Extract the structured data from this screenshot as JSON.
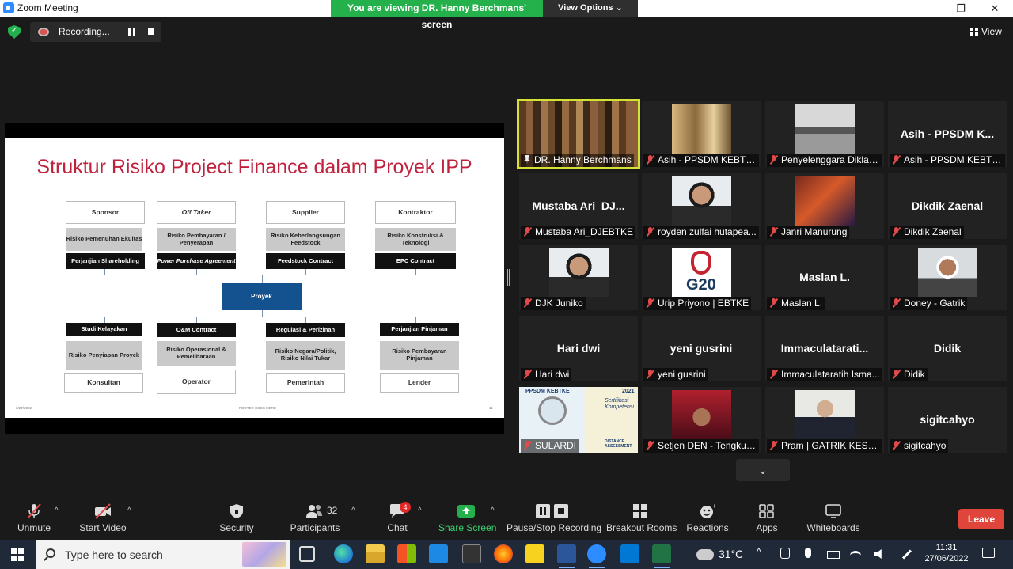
{
  "window": {
    "title": "Zoom Meeting",
    "minimize": "—",
    "maximize": "❐",
    "close": "✕"
  },
  "banner": {
    "viewing": "You are viewing DR. Hanny Berchmans' screen",
    "view_options": "View Options ⌄"
  },
  "recording": {
    "label": "Recording..."
  },
  "view_button": "View",
  "slide": {
    "title": "Struktur Risiko Project Finance dalam Proyek IPP",
    "top_columns": [
      {
        "header": "Sponsor",
        "risk": "Risiko Pemenuhan Ekuitas",
        "contract": "Perjanjian Shareholding"
      },
      {
        "header": "Off Taker",
        "risk": "Risiko Pembayaran / Penyerapan",
        "contract": "Power Purchase Agreement"
      },
      {
        "header": "Supplier",
        "risk": "Risiko Keberlangsungan Feedstock",
        "contract": "Feedstock Contract"
      },
      {
        "header": "Kontraktor",
        "risk": "Risiko Konstruksi & Teknologi",
        "contract": "EPC Contract"
      }
    ],
    "center": "Proyek",
    "bottom_columns": [
      {
        "contract": "Studi Kelayakan",
        "risk": "Risiko Penyiapan Proyek",
        "party": "Konsultan"
      },
      {
        "contract": "O&M Contract",
        "risk": "Risiko Operasional & Pemeliharaan",
        "party": "Operator"
      },
      {
        "contract": "Regulasi & Perizinan",
        "risk": "Risiko Negara/Politik, Risiko Nilai Tukar",
        "party": "Pemerintah"
      },
      {
        "contract": "Perjanjian Pinjaman",
        "risk": "Risiko Pembayaran Pinjaman",
        "party": "Lender"
      }
    ],
    "footer_left": "6/27/2022",
    "footer_center": "FOOTER GOES HERE",
    "footer_right": "11"
  },
  "participants": [
    {
      "big": "",
      "label": "DR. Hanny Berchmans",
      "active": true,
      "photo": "bookshelf"
    },
    {
      "big": "",
      "label": "Asih - PPSDM KEBTKE",
      "photo": "room"
    },
    {
      "big": "",
      "label": "Penyelenggara Diklat ...",
      "photo": "office"
    },
    {
      "big": "Asih - PPSDM K...",
      "label": "Asih - PPSDM KEBTKE"
    },
    {
      "big": "Mustaba Ari_DJ...",
      "label": "Mustaba Ari_DJEBTKE"
    },
    {
      "big": "",
      "label": "royden zulfai hutapea...",
      "photo": "man"
    },
    {
      "big": "",
      "label": "Janri Manurung",
      "photo": "stage"
    },
    {
      "big": "Dikdik Zaenal",
      "label": "Dikdik Zaenal"
    },
    {
      "big": "",
      "label": "DJK Juniko",
      "photo": "man"
    },
    {
      "big": "",
      "label": "Urip Priyono | EBTKE",
      "photo": "g20"
    },
    {
      "big": "Maslan L.",
      "label": "Maslan L."
    },
    {
      "big": "",
      "label": "Doney - Gatrik",
      "photo": "mask"
    },
    {
      "big": "Hari dwi",
      "label": "Hari dwi"
    },
    {
      "big": "yeni gusrini",
      "label": "yeni gusrini"
    },
    {
      "big": "Immaculatarati...",
      "label": "Immaculataratih Isma..."
    },
    {
      "big": "Didik",
      "label": "Didik"
    },
    {
      "big": "",
      "label": "SULARDI",
      "photo": "poster"
    },
    {
      "big": "",
      "label": "Setjen DEN - Tengku ...",
      "photo": "red"
    },
    {
      "big": "",
      "label": "Pram | GATRIK KESDM",
      "photo": "suit"
    },
    {
      "big": "sigitcahyo",
      "label": "sigitcahyo"
    }
  ],
  "g20_text": "G20",
  "poster_text": {
    "top": "PPSDM KEBTKE",
    "year": "2021",
    "subtitle": "Sertifikasi Kompetensi",
    "bottom": "DISTANCE ASSESSMENT"
  },
  "toolbar": {
    "unmute": "Unmute",
    "start_video": "Start Video",
    "security": "Security",
    "participants": "Participants",
    "participants_count": "32",
    "chat": "Chat",
    "chat_badge": "4",
    "share_screen": "Share Screen",
    "pause_share": "Pause/Stop Recording",
    "breakout": "Breakout Rooms",
    "reactions": "Reactions",
    "apps": "Apps",
    "whiteboards": "Whiteboards",
    "leave": "Leave"
  },
  "taskbar": {
    "search_placeholder": "Type here to search",
    "temperature": "31°C",
    "time": "11:31",
    "date": "27/06/2022"
  },
  "colors": {
    "viewing_banner": "#24b04b",
    "active_speaker": "#d4e236",
    "leave": "#e0453c",
    "share_screen": "#24b04b",
    "slide_title": "#c0213d"
  }
}
